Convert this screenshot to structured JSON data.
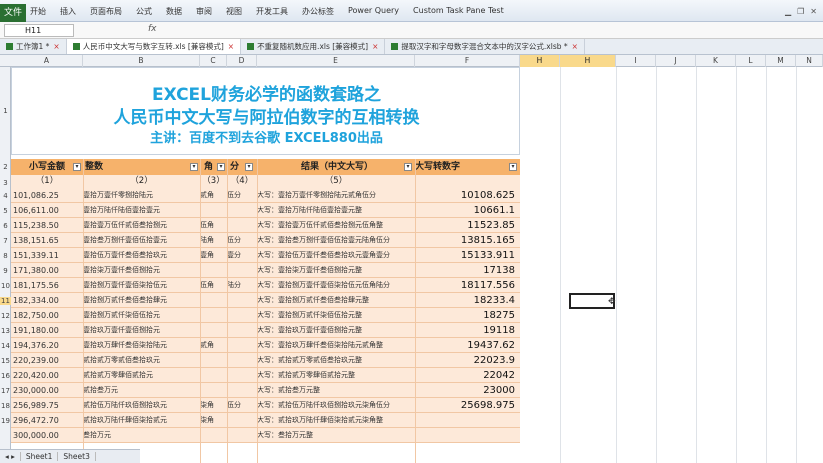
{
  "ribbon": {
    "file_label": "文件",
    "tabs": [
      "开始",
      "插入",
      "页面布局",
      "公式",
      "数据",
      "审阅",
      "视图",
      "开发工具",
      "办公标签",
      "Power Query",
      "Custom Task Pane Test"
    ]
  },
  "formula_bar": {
    "cell_ref": "H11",
    "fx": "fx"
  },
  "doc_tabs": [
    {
      "label": "工作簿1 *",
      "active": false
    },
    {
      "label": "人民币中文大写与数字互转.xls [兼容模式]",
      "active": true
    },
    {
      "label": "不重复随机数应用.xls [兼容模式]",
      "active": false
    },
    {
      "label": "提取汉字和字母数字混合文本中的汉字公式.xlsb *",
      "active": false
    }
  ],
  "columns": [
    "A",
    "B",
    "C",
    "D",
    "E",
    "F",
    "H",
    "H",
    "I",
    "J",
    "K",
    "L",
    "M",
    "N"
  ],
  "title": {
    "line1": "EXCEL财务必学的函数套路之",
    "line2": "人民币中文大写与阿拉伯数字的互相转换",
    "line3": "主讲：百度不到去谷歌  EXCEL880出品"
  },
  "table_header": {
    "amount": "小写金额",
    "integer": "整数",
    "jiao": "角",
    "fen": "分",
    "result": "结果（中文大写）",
    "number": "大写转数字"
  },
  "subheader": [
    "（1）",
    "（2）",
    "（3）",
    "（4）",
    "（5）"
  ],
  "row_numbers": [
    "1",
    "2",
    "3",
    "4",
    "5",
    "6",
    "7",
    "8",
    "9",
    "10",
    "11",
    "12",
    "13",
    "14",
    "15",
    "16",
    "17",
    "18",
    "19"
  ],
  "rows": [
    {
      "amount": "101,086.25",
      "integer": "壹拾万壹仟零捌拾陆元",
      "jiao": "贰角",
      "fen": "伍分",
      "result": "大写：壹拾万壹仟零捌拾陆元贰角伍分",
      "number": "10108.625"
    },
    {
      "amount": "106,611.00",
      "integer": "壹拾万陆仟陆佰壹拾壹元",
      "jiao": "",
      "fen": "",
      "result": "大写：壹拾万陆仟陆佰壹拾壹元整",
      "number": "10661.1"
    },
    {
      "amount": "115,238.50",
      "integer": "壹拾壹万伍仟贰佰叁拾捌元",
      "jiao": "伍角",
      "fen": "",
      "result": "大写：壹拾壹万伍仟贰佰叁拾捌元伍角整",
      "number": "11523.85"
    },
    {
      "amount": "138,151.65",
      "integer": "壹拾叁万捌仟壹佰伍拾壹元",
      "jiao": "陆角",
      "fen": "伍分",
      "result": "大写：壹拾叁万捌仟壹佰伍拾壹元陆角伍分",
      "number": "13815.165"
    },
    {
      "amount": "151,339.11",
      "integer": "壹拾伍万壹仟叁佰叁拾玖元",
      "jiao": "壹角",
      "fen": "壹分",
      "result": "大写：壹拾伍万壹仟叁佰叁拾玖元壹角壹分",
      "number": "15133.911"
    },
    {
      "amount": "171,380.00",
      "integer": "壹拾柒万壹仟叁佰捌拾元",
      "jiao": "",
      "fen": "",
      "result": "大写：壹拾柒万壹仟叁佰捌拾元整",
      "number": "17138"
    },
    {
      "amount": "181,175.56",
      "integer": "壹拾捌万壹仟壹佰柒拾伍元",
      "jiao": "伍角",
      "fen": "陆分",
      "result": "大写：壹拾捌万壹仟壹佰柒拾伍元伍角陆分",
      "number": "18117.556"
    },
    {
      "amount": "182,334.00",
      "integer": "壹拾捌万贰仟叁佰叁拾肆元",
      "jiao": "",
      "fen": "",
      "result": "大写：壹拾捌万贰仟叁佰叁拾肆元整",
      "number": "18233.4"
    },
    {
      "amount": "182,750.00",
      "integer": "壹拾捌万贰仟柒佰伍拾元",
      "jiao": "",
      "fen": "",
      "result": "大写：壹拾捌万贰仟柒佰伍拾元整",
      "number": "18275"
    },
    {
      "amount": "191,180.00",
      "integer": "壹拾玖万壹仟壹佰捌拾元",
      "jiao": "",
      "fen": "",
      "result": "大写：壹拾玖万壹仟壹佰捌拾元整",
      "number": "19118"
    },
    {
      "amount": "194,376.20",
      "integer": "壹拾玖万肆仟叁佰柒拾陆元",
      "jiao": "贰角",
      "fen": "",
      "result": "大写：壹拾玖万肆仟叁佰柒拾陆元贰角整",
      "number": "19437.62"
    },
    {
      "amount": "220,239.00",
      "integer": "贰拾贰万零贰佰叁拾玖元",
      "jiao": "",
      "fen": "",
      "result": "大写：贰拾贰万零贰佰叁拾玖元整",
      "number": "22023.9"
    },
    {
      "amount": "220,420.00",
      "integer": "贰拾贰万零肆佰贰拾元",
      "jiao": "",
      "fen": "",
      "result": "大写：贰拾贰万零肆佰贰拾元整",
      "number": "22042"
    },
    {
      "amount": "230,000.00",
      "integer": "贰拾叁万元",
      "jiao": "",
      "fen": "",
      "result": "大写：贰拾叁万元整",
      "number": "23000"
    },
    {
      "amount": "256,989.75",
      "integer": "贰拾伍万陆仟玖佰捌拾玖元",
      "jiao": "柒角",
      "fen": "伍分",
      "result": "大写：贰拾伍万陆仟玖佰捌拾玖元柒角伍分",
      "number": "25698.975"
    },
    {
      "amount": "296,472.70",
      "integer": "贰拾玖万陆仟肆佰柒拾贰元",
      "jiao": "柒角",
      "fen": "",
      "result": "大写：贰拾玖万陆仟肆佰柒拾贰元柒角整",
      "number": ""
    },
    {
      "amount": "300,000.00",
      "integer": "叁拾万元",
      "jiao": "",
      "fen": "",
      "result": "大写：叁拾万元整",
      "number": ""
    }
  ],
  "sheet_tabs": [
    "Sheet1",
    "Sheet3"
  ],
  "colors": {
    "header_orange": "#f6b26b",
    "row_fill": "#fde9d9",
    "title_blue": "#1fa3dc",
    "file_tab": "#2a6f32"
  }
}
